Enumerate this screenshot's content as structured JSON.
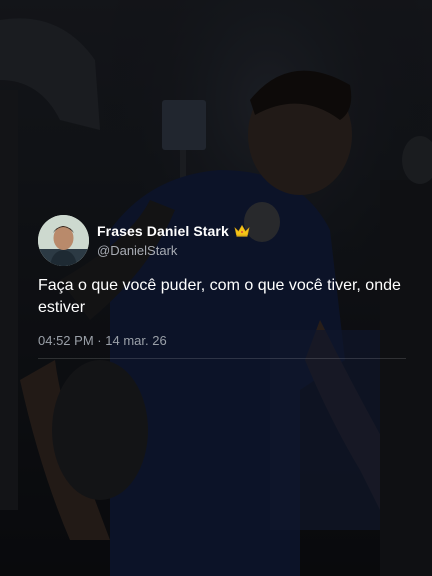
{
  "tweet": {
    "display_name": "Frases Daniel Stark",
    "handle": "@DanielStark",
    "text": "Faça o que você puder, com o que você tiver, onde estiver",
    "time": "04:52 PM",
    "separator": "·",
    "date": "14 mar. 26"
  },
  "icons": {
    "verified_badge": "crown-icon"
  },
  "colors": {
    "background": "#1a1d24",
    "text_primary": "#ffffff",
    "text_secondary": "#9aa0a8",
    "crown": "#f5c518"
  }
}
